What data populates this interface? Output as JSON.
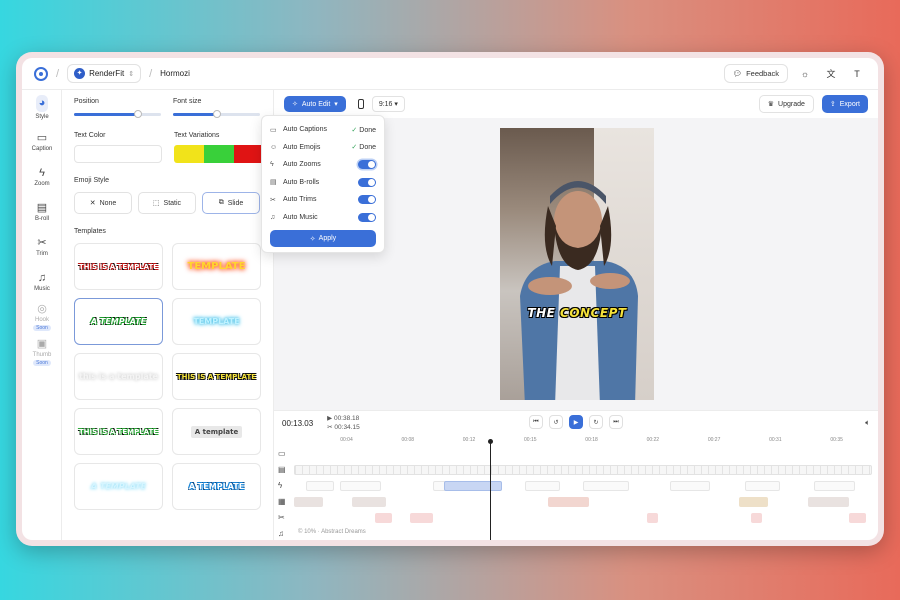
{
  "topbar": {
    "brand": "RenderFit",
    "project": "Hormozi",
    "feedback": "Feedback",
    "avatar_initial": "T"
  },
  "rail": {
    "items": [
      {
        "label": "Style",
        "icon": "palette-icon"
      },
      {
        "label": "Caption",
        "icon": "caption-icon"
      },
      {
        "label": "Zoom",
        "icon": "zoom-bolt-icon"
      },
      {
        "label": "B-roll",
        "icon": "film-icon"
      },
      {
        "label": "Trim",
        "icon": "scissors-icon"
      },
      {
        "label": "Music",
        "icon": "music-icon"
      },
      {
        "label": "Hook",
        "icon": "hook-icon",
        "badge": "Soon"
      },
      {
        "label": "Thumb",
        "icon": "image-icon",
        "badge": "Soon"
      }
    ]
  },
  "panel": {
    "position_label": "Position",
    "font_size_label": "Font size",
    "position_value": 0.73,
    "font_size_value": 0.5,
    "text_color_label": "Text Color",
    "text_variations_label": "Text Variations",
    "variation_colors": [
      "#f1e31a",
      "#39d03a",
      "#e01414"
    ],
    "emoji_style_label": "Emoji Style",
    "emoji_options": [
      "None",
      "Static",
      "Slide"
    ],
    "templates_label": "Templates",
    "templates": [
      "THIS IS A TEMPLATE",
      "TEMPLATE",
      "A TEMPLATE",
      "TEMPLATE",
      "this is a template",
      "THIS IS A TEMPLATE",
      "THIS IS A TEMPLATE",
      "A template",
      "A TEMPLATE",
      "A TEMPLATE"
    ]
  },
  "toolbar": {
    "auto_edit": "Auto Edit",
    "ratio": "9:16",
    "upgrade": "Upgrade",
    "export": "Export"
  },
  "dropdown": {
    "items": [
      {
        "label": "Auto Captions",
        "status": "Done"
      },
      {
        "label": "Auto Emojis",
        "status": "Done"
      },
      {
        "label": "Auto Zooms",
        "toggle": true
      },
      {
        "label": "Auto B-rolls",
        "toggle": true
      },
      {
        "label": "Auto Trims",
        "toggle": true
      },
      {
        "label": "Auto Music",
        "toggle": true
      }
    ],
    "apply": "Apply"
  },
  "video": {
    "caption_a": "THE",
    "caption_b": "CONCEPT"
  },
  "timeline": {
    "current_time": "00:13.03",
    "video_duration": "00:38.18",
    "trimmed_duration": "00:34.15",
    "ticks": [
      "00:04",
      "00:08",
      "00:12",
      "00:15",
      "00:18",
      "00:22",
      "00:27",
      "00:31",
      "00:35"
    ],
    "music": "© 10% · Abstract Dreams"
  },
  "colors": {
    "accent": "#3a6fd8",
    "done_check": "#35a35a"
  }
}
